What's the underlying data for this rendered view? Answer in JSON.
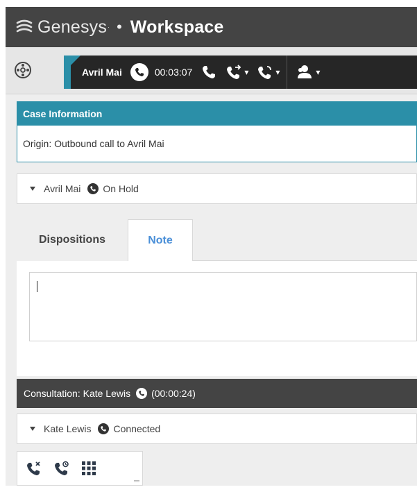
{
  "titlebar": {
    "brand": "Genesys",
    "brand_mark": "·",
    "separator": "•",
    "product": "Workspace",
    "logo_icon": "genesys-logo-icon"
  },
  "interaction_bar": {
    "caller_name": "Avril Mai",
    "timer": "00:03:07",
    "accent_color": "#2b8fa8",
    "icons": [
      "interaction-wheel-icon",
      "phone-badge-icon",
      "end-call-icon",
      "transfer-call-icon",
      "conference-call-icon",
      "consult-user-icon"
    ]
  },
  "case_info": {
    "header": "Case Information",
    "origin_label": "Origin:",
    "origin_value": "Outbound call to Avril Mai"
  },
  "party": {
    "name": "Avril Mai",
    "status": "On Hold"
  },
  "tabs": [
    {
      "label": "Dispositions",
      "active": false
    },
    {
      "label": "Note",
      "active": true
    }
  ],
  "note": {
    "value": ""
  },
  "consultation": {
    "label": "Consultation: Kate Lewis",
    "duration": "(00:00:24)",
    "party_name": "Kate Lewis",
    "party_status": "Connected"
  },
  "toolbox": {
    "icons": [
      "end-consult-call-icon",
      "hold-consult-icon",
      "dialpad-icon"
    ]
  }
}
